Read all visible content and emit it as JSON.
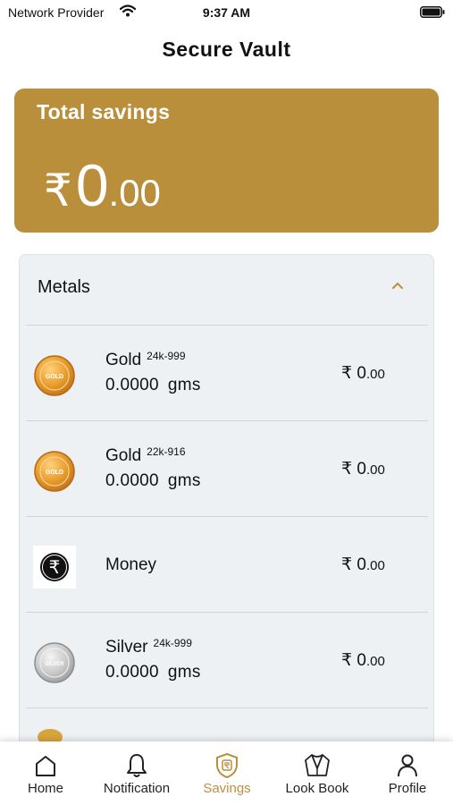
{
  "status_bar": {
    "carrier": "Network Provider",
    "time": "9:37 AM"
  },
  "header": {
    "title": "Secure Vault"
  },
  "savings": {
    "label": "Total savings",
    "currency": "₹",
    "integer": "0",
    "decimal": ".00"
  },
  "metals": {
    "title": "Metals",
    "items": [
      {
        "name": "Gold",
        "grade": "24k-999",
        "qty": "0.0000",
        "unit": "gms",
        "currency": "₹",
        "integer": " 0",
        "decimal": ".00",
        "icon": "gold-coin-icon"
      },
      {
        "name": "Gold",
        "grade": "22k-916",
        "qty": "0.0000",
        "unit": "gms",
        "currency": "₹",
        "integer": " 0",
        "decimal": ".00",
        "icon": "gold-coin-icon"
      },
      {
        "name": "Money",
        "currency": "₹",
        "integer": " 0",
        "decimal": ".00",
        "icon": "rupee-icon"
      },
      {
        "name": "Silver",
        "grade": "24k-999",
        "qty": "0.0000",
        "unit": "gms",
        "currency": "₹",
        "integer": " 0",
        "decimal": ".00",
        "icon": "silver-coin-icon"
      }
    ]
  },
  "tabs": [
    {
      "label": "Home",
      "icon": "home-icon"
    },
    {
      "label": "Notification",
      "icon": "bell-icon"
    },
    {
      "label": "Savings",
      "icon": "savings-shield-icon",
      "active": true
    },
    {
      "label": "Look Book",
      "icon": "jacket-icon"
    },
    {
      "label": "Profile",
      "icon": "person-icon"
    }
  ],
  "colors": {
    "accent": "#b98f3c",
    "panel": "#eef1f4",
    "divider": "#cfd5db"
  }
}
